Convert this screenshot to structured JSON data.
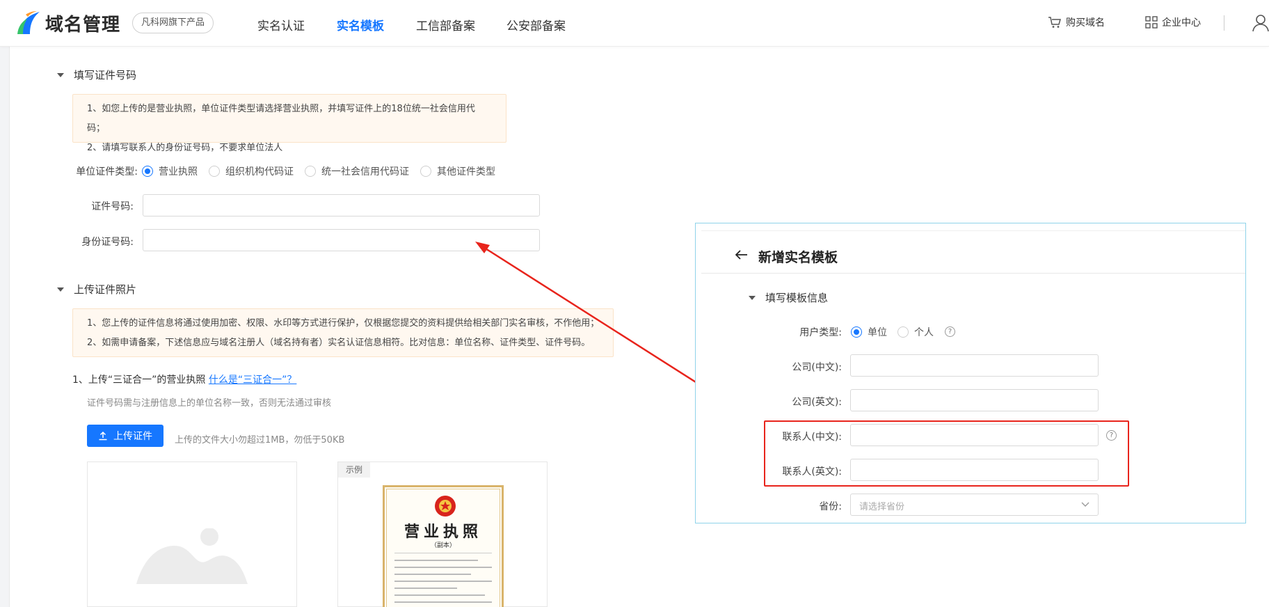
{
  "header": {
    "logo_text": "域名管理",
    "product_tag": "凡科网旗下产品",
    "nav": [
      {
        "label": "实名认证",
        "active": false
      },
      {
        "label": "实名模板",
        "active": true
      },
      {
        "label": "工信部备案",
        "active": false
      },
      {
        "label": "公安部备案",
        "active": false
      }
    ],
    "buy_domain": "购买域名",
    "enterprise_center": "企业中心"
  },
  "section_cert_number": {
    "title": "填写证件号码",
    "notice": [
      "1、如您上传的是营业执照，单位证件类型请选择营业执照，并填写证件上的18位统一社会信用代码；",
      "2、请填写联系人的身份证号码，不要求单位法人"
    ],
    "cert_type_label": "单位证件类型:",
    "cert_types": [
      "营业执照",
      "组织机构代码证",
      "统一社会信用代码证",
      "其他证件类型"
    ],
    "cert_type_selected": "营业执照",
    "cert_number_label": "证件号码:",
    "id_number_label": "身份证号码:"
  },
  "section_upload": {
    "title": "上传证件照片",
    "notice": [
      "1、您上传的证件信息将通过使用加密、权限、水印等方式进行保护，仅根据您提交的资料提供给相关部门实名审核，不作他用；",
      "2、如需申请备案，下述信息应与域名注册人（域名持有者）实名认证信息相符。比对信息：单位名称、证件类型、证件号码。"
    ],
    "step1_text": "1、上传“三证合一”的营业执照",
    "step1_link": "什么是“三证合一”？",
    "hint": "证件号码需与注册信息上的单位名称一致，否则无法通过审核",
    "upload_button": "上传证件",
    "upload_hint": "上传的文件大小勿超过1MB，勿低于50KB",
    "example_tag": "示例",
    "license_title": "营业执照",
    "license_sub": "（副本）"
  },
  "panel": {
    "title": "新增实名模板",
    "section_title": "填写模板信息",
    "user_type_label": "用户类型:",
    "user_types": [
      "单位",
      "个人"
    ],
    "user_type_selected": "单位",
    "company_cn_label": "公司(中文):",
    "company_en_label": "公司(英文):",
    "contact_cn_label": "联系人(中文):",
    "contact_en_label": "联系人(英文):",
    "province_label": "省份:",
    "province_placeholder": "请选择省份",
    "help_icon_text": "?"
  },
  "colors": {
    "accent": "#1677ff",
    "highlight_red": "#e8241c",
    "notice_bg": "#fff8f0"
  }
}
